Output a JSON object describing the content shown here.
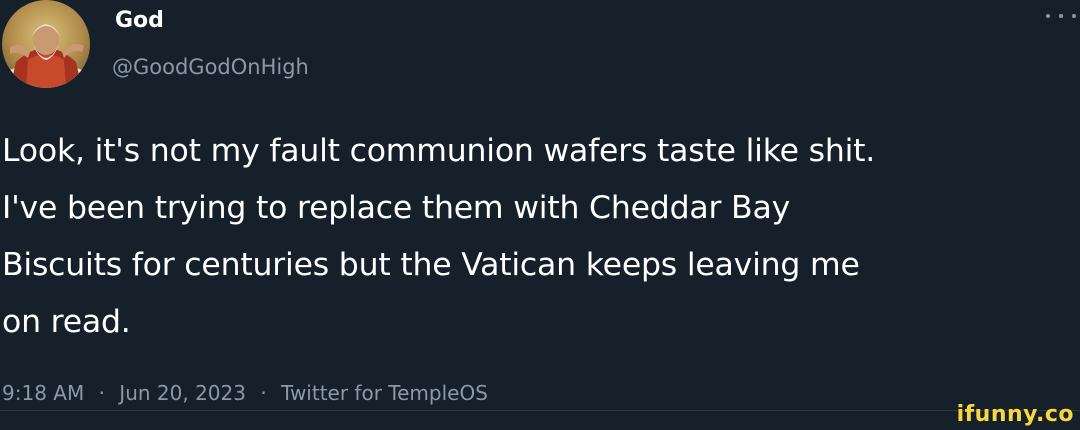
{
  "tweet": {
    "author": {
      "display_name": "God",
      "handle": "@GoodGodOnHigh",
      "avatar_icon": "painting-portrait-avatar"
    },
    "more_icon": "more-dots-icon",
    "text_lines": [
      "Look, it's not my fault communion wafers taste like shit.",
      "I've been trying to replace them with Cheddar Bay",
      "Biscuits for centuries but the Vatican keeps leaving me",
      "on read."
    ],
    "meta": {
      "time": "9:18 AM",
      "date": "Jun 20, 2023",
      "source": "Twitter for TempleOS",
      "separator": "·"
    }
  },
  "watermark": {
    "text": "ifunny.co",
    "color": "#f8d63c"
  },
  "colors": {
    "background": "#15202b",
    "primary_text": "#ffffff",
    "secondary_text": "#8b98a5"
  }
}
